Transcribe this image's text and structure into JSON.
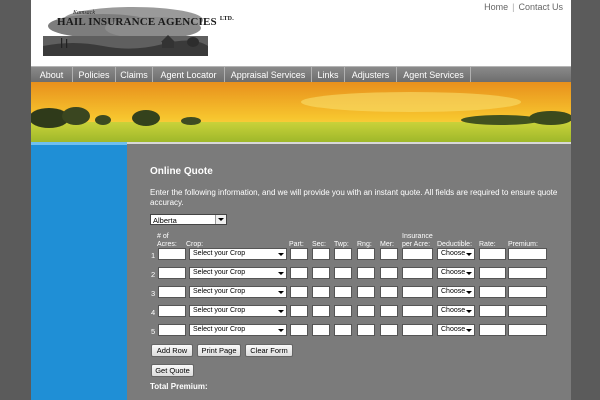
{
  "brand": {
    "name": "HAIL INSURANCE AGENCIES",
    "suffix": "LTD.",
    "tagline": "Kamsack"
  },
  "top_links": [
    "Home",
    "Contact Us"
  ],
  "nav": [
    "About",
    "Policies",
    "Claims",
    "Agent Locator",
    "Appraisal Services",
    "Links",
    "Adjusters",
    "Agent Services"
  ],
  "quote": {
    "title": "Online Quote",
    "instructions": "Enter the following information, and we will provide you with an instant quote. All fields are required to ensure quote accuracy.",
    "province": "Alberta",
    "headers": {
      "acres": "# of Acres:",
      "crop": "Crop:",
      "part": "Part:",
      "sec": "Sec:",
      "twp": "Twp:",
      "rng": "Rng:",
      "mer": "Mer:",
      "insurance": "Insurance per Acre:",
      "deductible": "Deductible:",
      "rate": "Rate:",
      "premium": "Premium:"
    },
    "rows": [
      {
        "num": "1",
        "crop": "Select your Crop",
        "deductible": "Choose"
      },
      {
        "num": "2",
        "crop": "Select your Crop",
        "deductible": "Choose"
      },
      {
        "num": "3",
        "crop": "Select your Crop",
        "deductible": "Choose"
      },
      {
        "num": "4",
        "crop": "Select your Crop",
        "deductible": "Choose"
      },
      {
        "num": "5",
        "crop": "Select your Crop",
        "deductible": "Choose"
      }
    ],
    "buttons": {
      "add_row": "Add Row",
      "print_page": "Print Page",
      "clear_form": "Clear Form",
      "get_quote": "Get Quote"
    },
    "total_label": "Total Premium:"
  }
}
